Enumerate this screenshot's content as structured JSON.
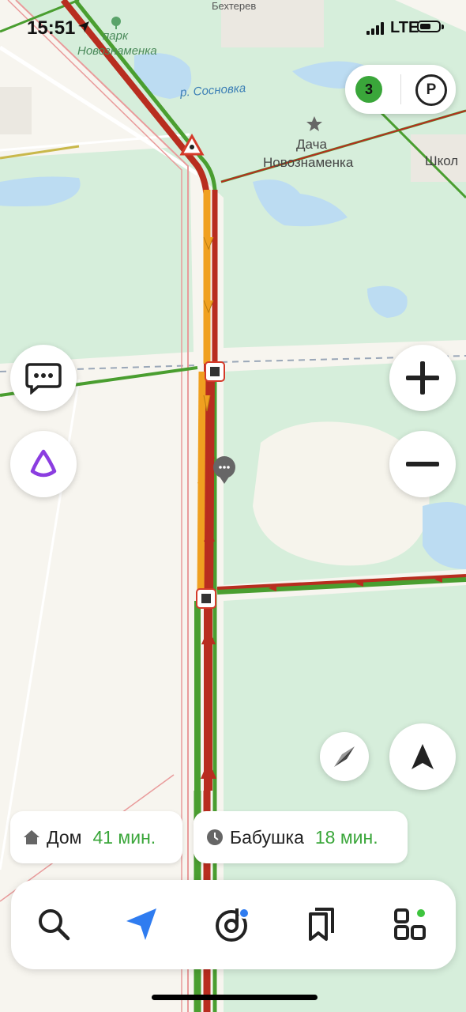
{
  "status_bar": {
    "time": "15:51",
    "network": "LTE"
  },
  "map": {
    "labels": {
      "top_place": "Бехтерев",
      "park": "парк",
      "park_name": "Новознаменка",
      "river": "р. Сосновка",
      "poi_line1": "Дача",
      "poi_line2": "Новознаменка",
      "school": "Школ"
    },
    "colors": {
      "jam_red": "#b82d1f",
      "slow_orange": "#f0a020",
      "free_green": "#4a9e30"
    }
  },
  "traffic_score": "3",
  "parking_symbol": "P",
  "destinations": [
    {
      "name": "Дом",
      "eta": "41 мин.",
      "icon": "home-icon"
    },
    {
      "name": "Бабушка",
      "eta": "18 мин.",
      "icon": "clock-icon"
    }
  ],
  "tabbar": {
    "items": [
      {
        "icon": "search-icon"
      },
      {
        "icon": "navigator-arrow-icon"
      },
      {
        "icon": "music-icon"
      },
      {
        "icon": "bookmarks-icon"
      },
      {
        "icon": "services-grid-icon"
      }
    ]
  }
}
